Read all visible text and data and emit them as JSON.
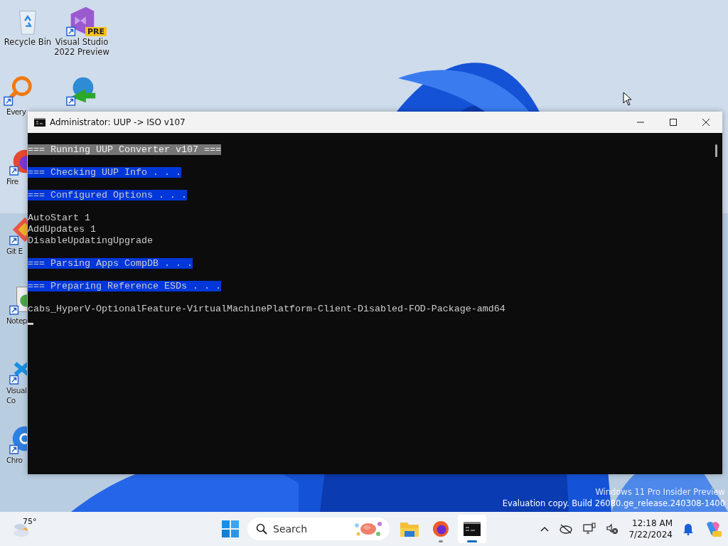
{
  "desktop_icons": [
    {
      "kind": "recycle",
      "lines": [
        "Recycle Bin"
      ]
    },
    {
      "kind": "vs",
      "lines": [
        "Visual Studio",
        "2022 Preview"
      ],
      "badge": "PRE"
    },
    {
      "kind": "everything",
      "lines": [
        "Every"
      ]
    },
    {
      "kind": "idm"
    },
    {
      "kind": "firefox",
      "lines": [
        "Fire"
      ]
    },
    {
      "kind": "git",
      "lines": [
        "Git E"
      ]
    },
    {
      "kind": "notepad",
      "lines": [
        "Notep"
      ]
    },
    {
      "kind": "vscode",
      "lines": [
        "Visual",
        "Co"
      ]
    },
    {
      "kind": "chrome",
      "lines": [
        "Chro"
      ]
    }
  ],
  "window": {
    "title": "Administrator:  UUP -> ISO v107"
  },
  "console": [
    {
      "kind": "blank"
    },
    {
      "kind": "banner-gray",
      "text": "=== Running UUP Converter v107 ==="
    },
    {
      "kind": "blank"
    },
    {
      "kind": "banner",
      "text": "=== Checking UUP Info . . ."
    },
    {
      "kind": "blank"
    },
    {
      "kind": "banner",
      "text": "=== Configured Options . . ."
    },
    {
      "kind": "blank"
    },
    {
      "kind": "text",
      "text": "AutoStart 1"
    },
    {
      "kind": "text",
      "text": "AddUpdates 1"
    },
    {
      "kind": "text",
      "text": "DisableUpdatingUpgrade"
    },
    {
      "kind": "blank"
    },
    {
      "kind": "banner",
      "text": "=== Parsing Apps CompDB . . ."
    },
    {
      "kind": "blank"
    },
    {
      "kind": "banner",
      "text": "=== Preparing Reference ESDs . . ."
    },
    {
      "kind": "blank"
    },
    {
      "kind": "text",
      "text": "cabs_HyperV-OptionalFeature-VirtualMachinePlatform-Client-Disabled-FOD-Package-amd64"
    },
    {
      "kind": "cursor"
    }
  ],
  "watermark": [
    "Windows 11 Pro Insider Preview",
    "Evaluation copy. Build 26080.ge_release.240308-1400"
  ],
  "taskbar": {
    "weather": "75°",
    "search": {
      "placeholder": "Search"
    },
    "apps": [
      {
        "kind": "explorer",
        "active": false
      },
      {
        "kind": "firefox",
        "active": false,
        "running": true
      },
      {
        "kind": "terminal",
        "active": true,
        "running": true
      }
    ],
    "time": "12:18 AM",
    "date": "7/22/2024"
  }
}
